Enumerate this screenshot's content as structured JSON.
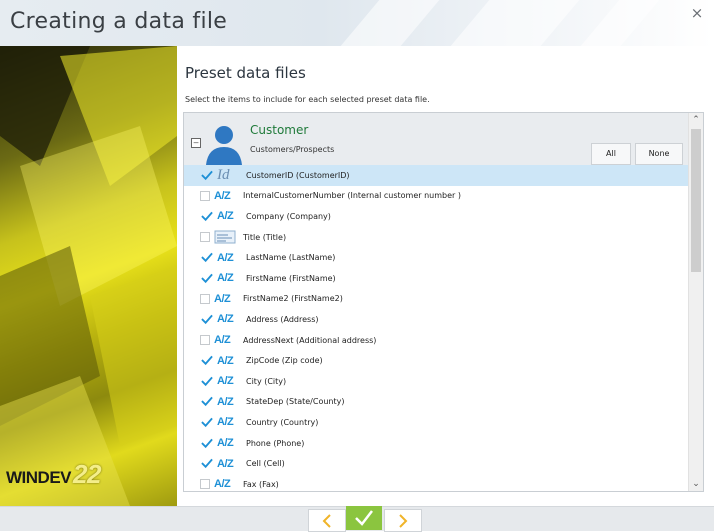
{
  "window": {
    "title": "Creating a data file",
    "close_label": "×"
  },
  "brand": {
    "name": "WINDEV",
    "version": "22"
  },
  "main": {
    "section_title": "Preset data files",
    "description": "Select the items to include for each selected preset data file."
  },
  "group": {
    "title": "Customer",
    "subtitle": "Customers/Prospects",
    "expanded_symbol": "–",
    "all_label": "All",
    "none_label": "None"
  },
  "items": [
    {
      "label": "CustomerID (CustomerID)",
      "checked": true,
      "type": "id",
      "selected": true
    },
    {
      "label": "InternalCustomerNumber (Internal customer number )",
      "checked": false,
      "type": "text"
    },
    {
      "label": "Company (Company)",
      "checked": true,
      "type": "text"
    },
    {
      "label": "Title (Title)",
      "checked": false,
      "type": "combo"
    },
    {
      "label": "LastName (LastName)",
      "checked": true,
      "type": "text"
    },
    {
      "label": "FirstName (FirstName)",
      "checked": true,
      "type": "text"
    },
    {
      "label": "FirstName2 (FirstName2)",
      "checked": false,
      "type": "text"
    },
    {
      "label": "Address (Address)",
      "checked": true,
      "type": "text"
    },
    {
      "label": "AddressNext (Additional address)",
      "checked": false,
      "type": "text"
    },
    {
      "label": "ZipCode (Zip code)",
      "checked": true,
      "type": "text"
    },
    {
      "label": "City (City)",
      "checked": true,
      "type": "text"
    },
    {
      "label": "StateDep (State/County)",
      "checked": true,
      "type": "text"
    },
    {
      "label": "Country (Country)",
      "checked": true,
      "type": "text"
    },
    {
      "label": "Phone (Phone)",
      "checked": true,
      "type": "text"
    },
    {
      "label": "Cell (Cell)",
      "checked": true,
      "type": "text"
    },
    {
      "label": "Fax (Fax)",
      "checked": false,
      "type": "text"
    }
  ],
  "type_glyphs": {
    "text": "A/Z",
    "id": "Id"
  },
  "icons": {
    "check": "check-icon",
    "text_type": "text-type-icon",
    "id_type": "id-type-icon",
    "combo_type": "combo-type-icon",
    "avatar": "person-icon"
  },
  "colors": {
    "accent_green": "#8bc53f",
    "title_green": "#1f7a3a",
    "type_blue": "#1e90d6",
    "selected_row": "#cde6f7"
  }
}
